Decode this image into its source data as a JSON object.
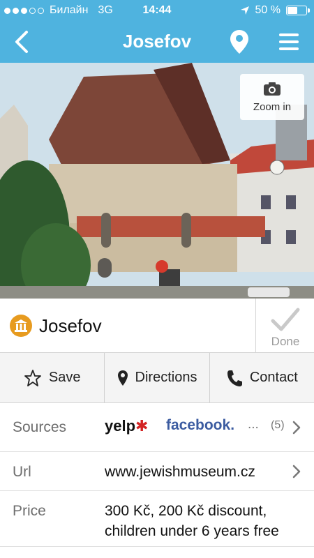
{
  "status_bar": {
    "carrier": "Билайн",
    "network": "3G",
    "time": "14:44",
    "battery": "50 %",
    "battery_level": 0.5,
    "signal_bars_filled": 3,
    "signal_bars_total": 5
  },
  "nav": {
    "title": "Josefov",
    "back_icon": "chevron-left-icon",
    "location_icon": "map-pin-icon",
    "menu_icon": "hamburger-menu-icon"
  },
  "photo": {
    "zoom_label": "Zoom in",
    "zoom_icon": "camera-icon"
  },
  "place": {
    "name": "Josefov",
    "category_icon": "museum-icon",
    "done_label": "Done"
  },
  "actions": {
    "save": "Save",
    "directions": "Directions",
    "contact": "Contact"
  },
  "details": {
    "sources_label": "Sources",
    "sources": {
      "yelp": "yelp",
      "facebook": "facebook.",
      "more": "...",
      "count": "(5)"
    },
    "url_label": "Url",
    "url_value": "www.jewishmuseum.cz",
    "price_label": "Price",
    "price_line1": "300 Kč, 200 Kč discount,",
    "price_line2": "children under 6 years free"
  },
  "colors": {
    "header": "#4fb3df",
    "museum_badge": "#e79b1f",
    "yelp_red": "#d32323",
    "facebook_blue": "#3b5ba0"
  }
}
